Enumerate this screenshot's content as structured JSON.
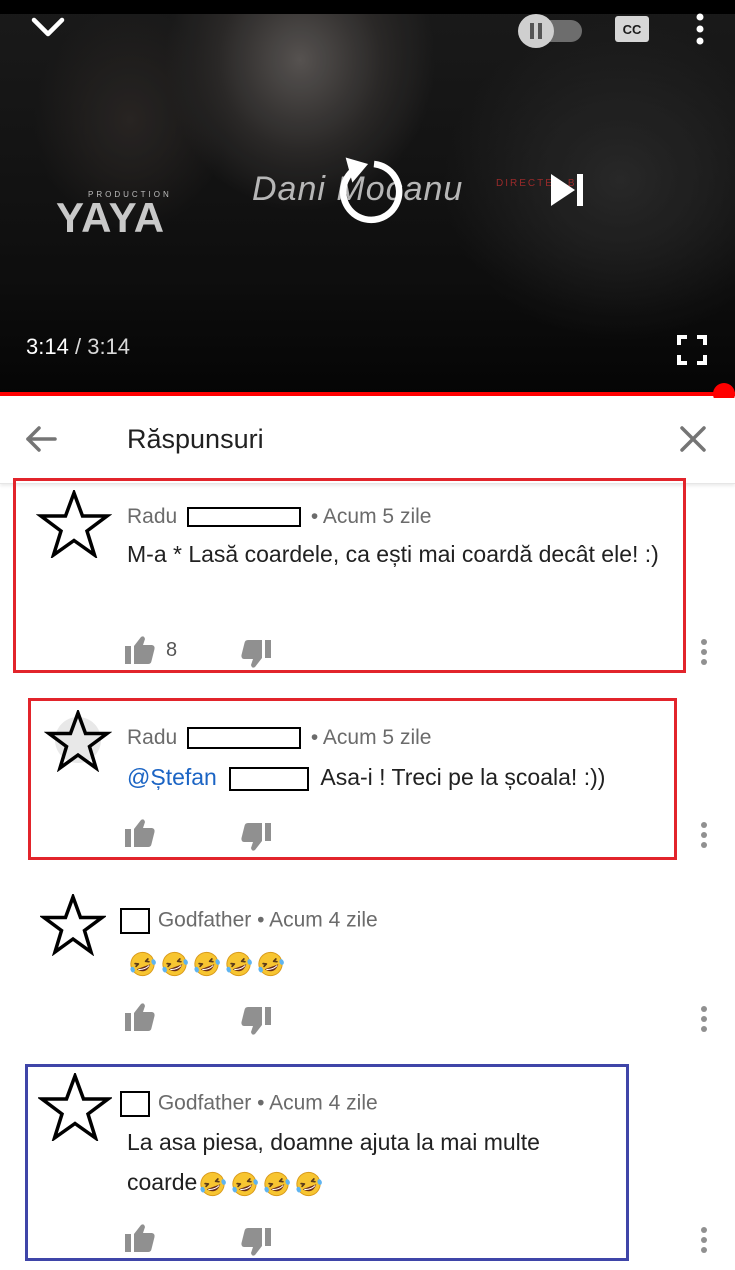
{
  "player": {
    "logo_small": "PRODUCTION",
    "logo_big": "YAYA",
    "watermark": "Dani Mocanu",
    "directed_by": "DIRECTED BY",
    "current_time": "3:14",
    "separator": "/",
    "duration": "3:14",
    "progress_fraction": 1.0,
    "accent_color": "#ff0000"
  },
  "header": {
    "title": "Răspunsuri"
  },
  "comments": [
    {
      "author": "Radu",
      "time": "• Acum 5 zile",
      "text": "M-a * Lasă coardele, ca ești mai coardă decât ele! :)",
      "likes": "8"
    },
    {
      "author": "Radu",
      "time": "• Acum 5 zile",
      "mention": "@Ștefan",
      "text": "Asa-i ! Treci pe la școala! :))"
    },
    {
      "author": "Godfather",
      "time": "• Acum 4 zile",
      "emoji_count": 5
    },
    {
      "author": "Godfather",
      "time": "• Acum 4 zile",
      "text_line1": "La asa piesa, doamne ajuta la mai multe",
      "text_line2": "coarde",
      "emoji_count": 4
    }
  ],
  "highlight_colors": {
    "red": "#e2242b",
    "blue": "#3f45a8"
  }
}
